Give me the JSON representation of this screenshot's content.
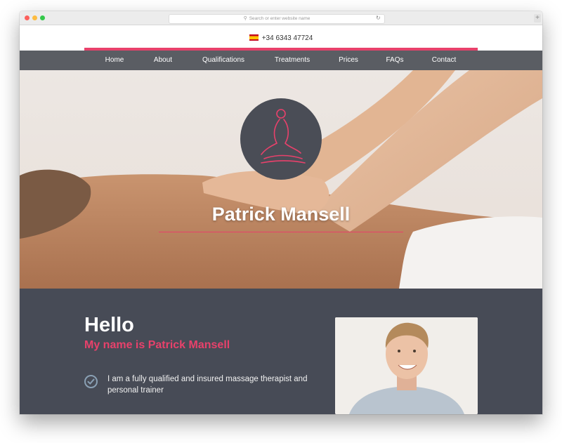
{
  "browser": {
    "url_placeholder": "Search or enter website name",
    "reload_icon": "reload-icon",
    "newtab_icon": "plus-icon"
  },
  "topbar": {
    "flag": "spain-flag-icon",
    "phone": "+34 6343 47724"
  },
  "nav": {
    "items": [
      {
        "label": "Home",
        "active": true
      },
      {
        "label": "About"
      },
      {
        "label": "Qualifications"
      },
      {
        "label": "Treatments"
      },
      {
        "label": "Prices"
      },
      {
        "label": "FAQs"
      },
      {
        "label": "Contact"
      }
    ]
  },
  "hero": {
    "logo": "massage-logo-icon",
    "title": "Patrick Mansell"
  },
  "about": {
    "heading": "Hello",
    "subheading": "My name is Patrick Mansell",
    "bullets": [
      {
        "icon": "check-circle-icon",
        "text": "I am a fully qualified and insured massage therapist and personal trainer"
      }
    ]
  },
  "colors": {
    "accent": "#e8416b",
    "nav_bg": "#5a5d63",
    "section_bg": "#474b56",
    "active_indicator": "#6a7f93"
  }
}
